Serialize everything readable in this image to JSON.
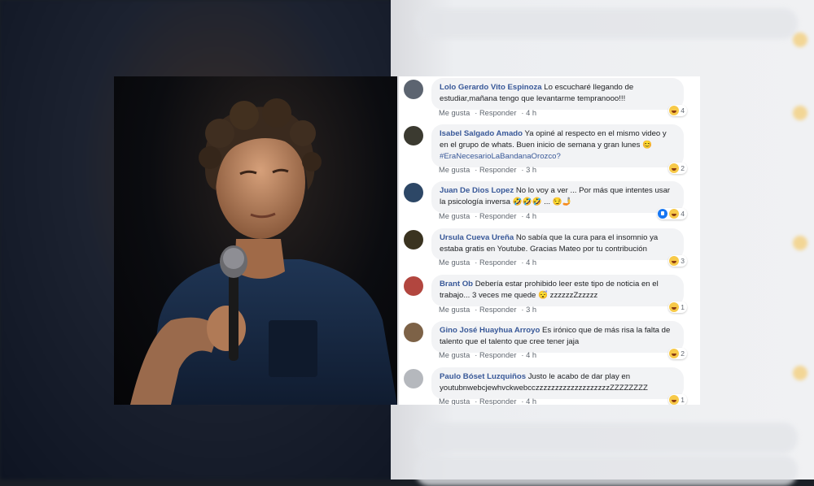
{
  "comments": [
    {
      "author": "Lolo Gerardo Vito Espinoza",
      "text": "Lo escucharé llegando de estudiar,mañana tengo que levantarme tempranooo!!!",
      "like": "Me gusta",
      "reply": "Responder",
      "time": "4 h",
      "reactions": "4"
    },
    {
      "author": "Isabel Salgado Amado",
      "text": "Ya opiné al respecto en el mismo video y en el grupo de whats. Buen inicio de semana y gran lunes 😊",
      "hashtag": "#EraNecesarioLaBandanaOrozco?",
      "like": "Me gusta",
      "reply": "Responder",
      "time": "3 h",
      "reactions": "2"
    },
    {
      "author": "Juan De Dios Lopez",
      "text": "No lo voy a ver ... Por más que intentes usar la psicología inversa 🤣🤣🤣 ... 😏🤳",
      "like": "Me gusta",
      "reply": "Responder",
      "time": "4 h",
      "reactions": "4"
    },
    {
      "author": "Ursula Cueva Ureña",
      "text": "No sabía que la cura para el insomnio ya estaba gratis en Youtube. Gracias Mateo por tu contribución",
      "like": "Me gusta",
      "reply": "Responder",
      "time": "4 h",
      "reactions": "3"
    },
    {
      "author": "Brant Ob",
      "text": "Debería estar prohibido leer este tipo de noticia en el trabajo... 3 veces me quede 😴 zzzzzzZzzzzz",
      "like": "Me gusta",
      "reply": "Responder",
      "time": "3 h",
      "reactions": "1"
    },
    {
      "author": "Gino José Huayhua Arroyo",
      "text": "Es irónico que de más risa la falta de talento que el talento que cree tener jaja",
      "like": "Me gusta",
      "reply": "Responder",
      "time": "4 h",
      "reactions": "2"
    },
    {
      "author": "Paulo Bóset Luzquiños",
      "text": "Justo le acabo de dar play en youtubnwebcjewhvckwebcczzzzzzzzzzzzzzzzzzzZZZZZZZZ",
      "like": "Me gusta",
      "reply": "Responder",
      "time": "4 h",
      "reactions": "1"
    }
  ]
}
